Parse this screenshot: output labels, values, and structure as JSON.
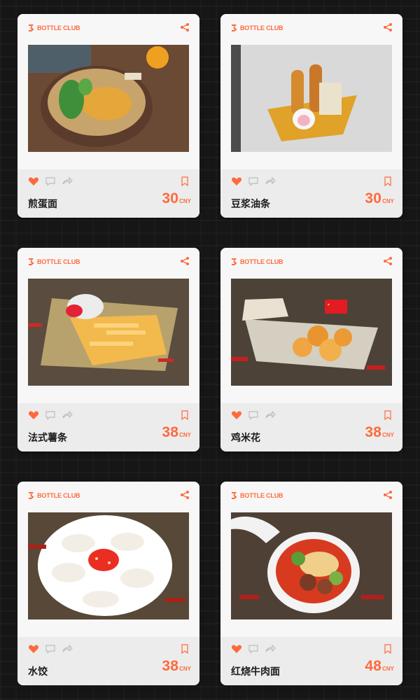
{
  "theme": {
    "accent": "#ff6a3d",
    "background": "#161616",
    "card_bg": "#f7f7f7",
    "card_footer_bg": "#ececec"
  },
  "brand": "BOTTLE CLUB",
  "currency": "CNY",
  "items": [
    {
      "name": "煎蛋面",
      "price": "30"
    },
    {
      "name": "豆浆油条",
      "price": "30"
    },
    {
      "name": "法式薯条",
      "price": "38"
    },
    {
      "name": "鸡米花",
      "price": "38"
    },
    {
      "name": "水饺",
      "price": "38"
    },
    {
      "name": "红烧牛肉面",
      "price": "48"
    }
  ]
}
